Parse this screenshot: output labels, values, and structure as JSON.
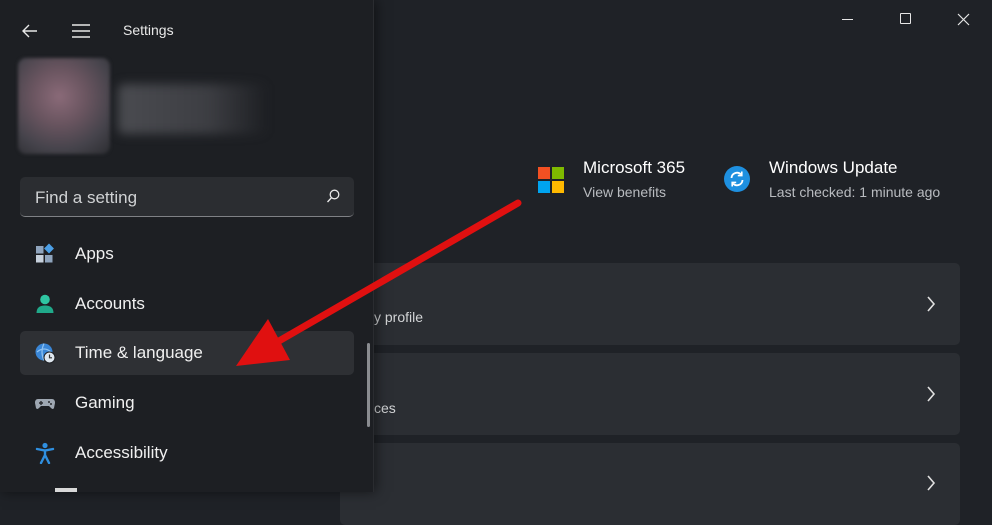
{
  "app": {
    "title": "Settings"
  },
  "search": {
    "placeholder": "Find a setting",
    "value": ""
  },
  "nav": {
    "items": [
      {
        "label": "Apps",
        "icon": "apps-icon"
      },
      {
        "label": "Accounts",
        "icon": "accounts-icon"
      },
      {
        "label": "Time & language",
        "icon": "time-language-icon",
        "selected": true
      },
      {
        "label": "Gaming",
        "icon": "gaming-icon"
      },
      {
        "label": "Accessibility",
        "icon": "accessibility-icon"
      }
    ]
  },
  "header_cards": {
    "microsoft365": {
      "title": "Microsoft 365",
      "subtitle": "View benefits"
    },
    "windows_update": {
      "title": "Windows Update",
      "subtitle": "Last checked: 1 minute ago"
    }
  },
  "rows": [
    {
      "text": "y profile"
    },
    {
      "text": "ces"
    },
    {
      "text": ""
    }
  ],
  "colors": {
    "accent": "#1e90e0",
    "arrow": "#e01010",
    "ms_red": "#f25022",
    "ms_green": "#7fba00",
    "ms_blue": "#00a4ef",
    "ms_yellow": "#ffb900"
  }
}
